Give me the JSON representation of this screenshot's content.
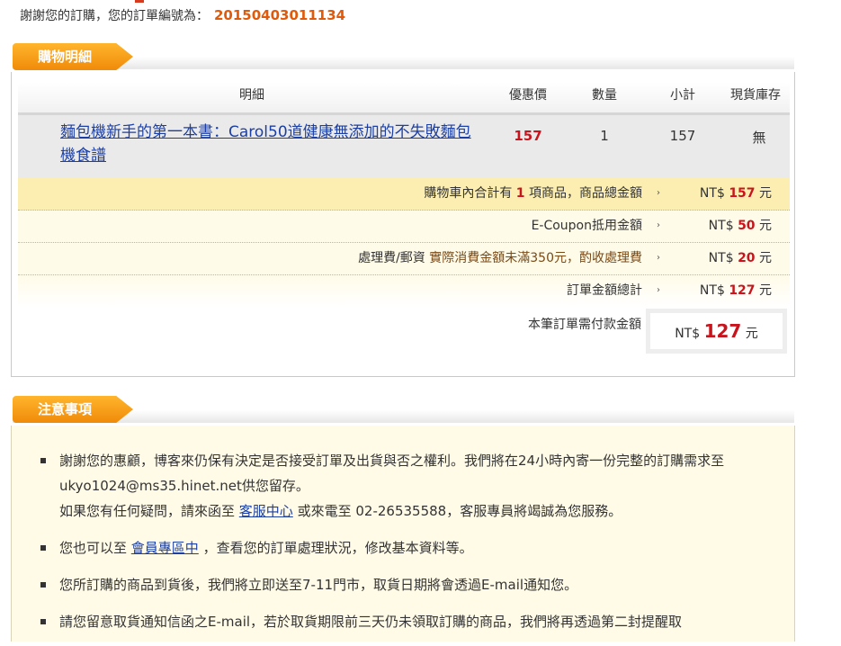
{
  "header": {
    "thanks_text": "謝謝您的訂購，您的訂單編號為：",
    "order_number": "20150403011134"
  },
  "sections": {
    "details_title": "購物明細",
    "notice_title": "注意事項"
  },
  "table": {
    "columns": [
      "明細",
      "優惠價",
      "數量",
      "小計",
      "現貨庫存"
    ],
    "items": [
      {
        "title": "麵包機新手的第一本書：Carol50道健康無添加的不失敗麵包機食譜",
        "price": "157",
        "qty": "1",
        "subtotal": "157",
        "stock": "無"
      }
    ]
  },
  "summary": {
    "cart_prefix": "購物車內合計有",
    "cart_count": "1",
    "cart_suffix": "項商品，商品總金額",
    "cart_currency": "NT$",
    "cart_amount": "157",
    "cart_unit": "元",
    "coupon_label": "E-Coupon抵用金額",
    "coupon_currency": "NT$",
    "coupon_amount": "50",
    "coupon_unit": "元",
    "fee_label": "處理費/郵資",
    "fee_note": "實際消費金額未滿350元，酌收處理費",
    "fee_currency": "NT$",
    "fee_amount": "20",
    "fee_unit": "元",
    "total_label": "訂單金額總計",
    "total_currency": "NT$",
    "total_amount": "127",
    "total_unit": "元",
    "pay_label": "本筆訂單需付款金額",
    "pay_currency": "NT$",
    "pay_amount": "127",
    "pay_unit": "元",
    "arrow": "›"
  },
  "notices": {
    "n1_line1": "謝謝您的惠顧，博客來仍保有決定是否接受訂單及出貨與否之權利。我們將在24小時內寄一份完整的訂購需求至ukyo1024@ms35.hinet.net供您留存。",
    "n1_line2_pre": "如果您有任何疑問，請來函至",
    "n1_link": "客服中心",
    "n1_line2_post": "或來電至 02-26535588，客服專員將竭誠為您服務。",
    "n2_pre": "您也可以至",
    "n2_link": "會員專區中",
    "n2_post": "，查看您的訂單處理狀況，修改基本資料等。",
    "n3": "您所訂購的商品到貨後，我們將立即送至7-11門市，取貨日期將會透過E-mail通知您。",
    "n4": "請您留意取貨通知信函之E-mail，若於取貨期限前三天仍未領取訂購的商品，我們將再透過第二封提醒取"
  },
  "colors": {
    "accent_orange": "#f08b0a",
    "order_number": "#e05a0c",
    "price_red": "#c8141c",
    "link_blue": "#1b3fa5"
  }
}
